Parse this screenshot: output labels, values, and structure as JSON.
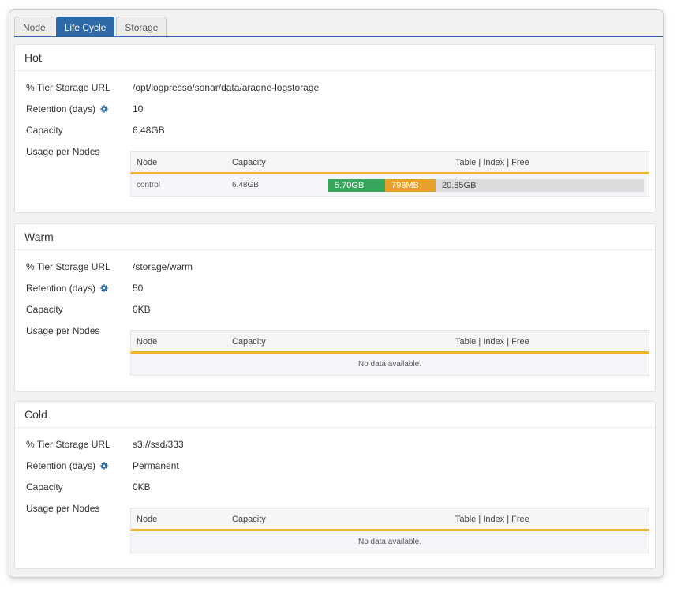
{
  "tabs": [
    {
      "label": "Node",
      "active": false
    },
    {
      "label": "Life Cycle",
      "active": true
    },
    {
      "label": "Storage",
      "active": false
    }
  ],
  "labels": {
    "storage_url": "% Tier Storage URL",
    "retention": "Retention (days)",
    "capacity": "Capacity",
    "usage": "Usage per Nodes"
  },
  "table_headers": {
    "node": "Node",
    "capacity": "Capacity",
    "bar": "Table | Index | Free"
  },
  "colors": {
    "accent": "#2f6aa8",
    "table_seg": "#3aa55d",
    "index_seg": "#e8a02d",
    "free_seg": "#dcdcdc",
    "header_rule": "#f0b429"
  },
  "tiers": [
    {
      "title": "Hot",
      "storage_url": "/opt/logpresso/sonar/data/araqne-logstorage",
      "retention": "10",
      "capacity": "6.48GB",
      "rows": [
        {
          "node": "control",
          "capacity": "6.48GB",
          "table": "5.70GB",
          "index": "798MB",
          "free": "20.85GB",
          "table_fraction": 0.18,
          "index_fraction": 0.16
        }
      ],
      "empty_text": ""
    },
    {
      "title": "Warm",
      "storage_url": "/storage/warm",
      "retention": "50",
      "capacity": "0KB",
      "rows": [],
      "empty_text": "No data available."
    },
    {
      "title": "Cold",
      "storage_url": "s3://ssd/333",
      "retention": "Permanent",
      "capacity": "0KB",
      "rows": [],
      "empty_text": "No data available."
    }
  ]
}
